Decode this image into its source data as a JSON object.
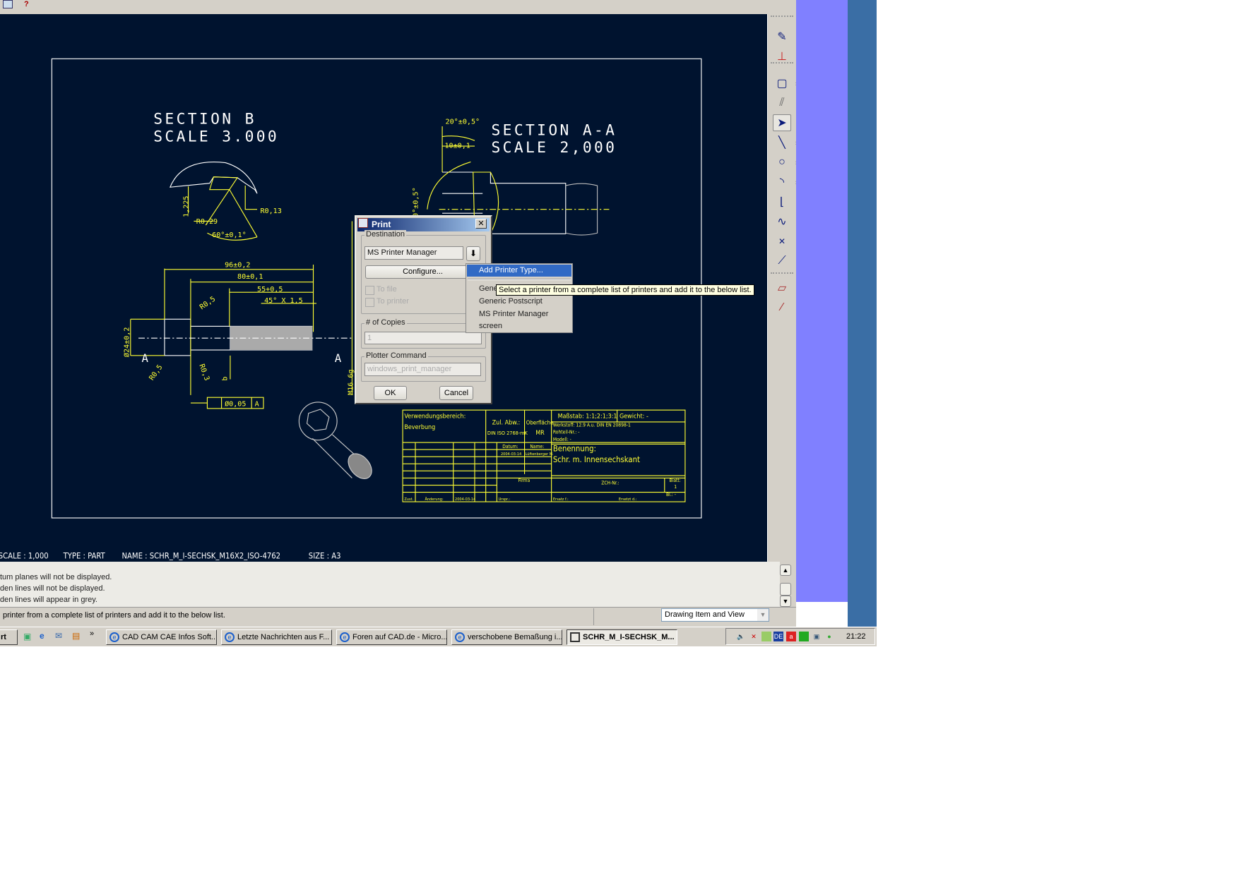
{
  "drawing": {
    "section_b_title": "SECTION  B",
    "section_b_scale": "SCALE  3.000",
    "section_aa_title": "SECTION  A-A",
    "section_aa_scale": "SCALE  2,000",
    "dims": {
      "r013": "R0,13",
      "r029": "R0,29",
      "d1225": "1,225",
      "a60": "60°±0,1°",
      "a20": "20°±0,5°",
      "d10": "10±0,1",
      "a30": "0°±0,5°",
      "d96": "96±0,2",
      "d80": "80±0,1",
      "d55": "55+0,5",
      "ch45": "45° X 1,5",
      "r05a": "R0,5",
      "r05b": "R0,5",
      "r03": "R0,3",
      "dia24": "Ø24±0,2",
      "b": "b",
      "a_left": "A",
      "a_right": "A",
      "m16": "M16  6g",
      "tol": "Ø0,05",
      "datum": "A"
    },
    "title_block": {
      "usage": "Verwendungsbereich:",
      "coating": "Beverbung",
      "zul": "Zul. Abw.:",
      "din": "DIN ISO 2768-mK",
      "surface": "Oberfläche:",
      "surface_val": "MR",
      "scale": "Maßstab: 1:1;2:1;3:1",
      "weight": "Gewicht: -",
      "material": "Werkstoff: 12.9 A.u. DIN EN 20898-1",
      "blank": "Rohteil-Nr.: -",
      "model": "Modell: -",
      "datum": "Datum:",
      "name": "Name:",
      "date_val": "2004-03-14",
      "name_val": "Lüftenberger M.",
      "designation": "Benennung:",
      "designation_val": "Schr. m. Innensechskant",
      "firm": "Firma",
      "zeich": "ZCH-Nr.:",
      "sheet": "Blatt:",
      "sheet_val": "1",
      "bl": "Bl.: -",
      "zust": "Zust.",
      "change": "Änderung:",
      "change_date": "2004-03-14",
      "origin": "Urspr.:",
      "ersatz": "Ersatz f.:",
      "ersetzt": "Ersetzt d.:"
    },
    "info": {
      "scale": "SCALE : 1,000",
      "type": "TYPE : PART",
      "name": "NAME : SCHR_M_I-SECHSK_M16X2_ISO-4762",
      "size": "SIZE : A3"
    }
  },
  "messages": [
    "tum planes will not be displayed.",
    "den lines will not be displayed.",
    "den lines will appear in grey."
  ],
  "status": {
    "text": " printer from a complete list of printers and add it to the below list.",
    "filter": "Drawing Item and View"
  },
  "dialog": {
    "title": "Print",
    "destination_label": "Destination",
    "destination_value": "MS Printer Manager",
    "configure": "Configure...",
    "to_file": "To file",
    "to_printer": "To printer",
    "copies_label": "# of Copies",
    "copies_value": "1",
    "plotter_label": "Plotter Command",
    "plotter_value": "windows_print_manager",
    "ok": "OK",
    "cancel": "Cancel"
  },
  "menu": {
    "items": [
      "Add Printer Type...",
      "Generic",
      "Generic Postscript",
      "MS Printer Manager",
      "screen"
    ],
    "highlighted": 0
  },
  "tooltip": "Select a printer from a complete list of printers and add it to the below list.",
  "taskbar": {
    "start": "rt",
    "tasks": [
      "CAD CAM CAE Infos Soft...",
      "Letzte Nachrichten aus F...",
      "Foren auf CAD.de - Micro...",
      "verschobene Bemaßung i...",
      "SCHR_M_I-SECHSK_M..."
    ],
    "clock": "21:22",
    "lang": "DE"
  },
  "colors": {
    "viewport": "#00132f",
    "drawing_lines": "#ffff33",
    "geometry": "#ffffff",
    "highlight": "#316ac5"
  }
}
